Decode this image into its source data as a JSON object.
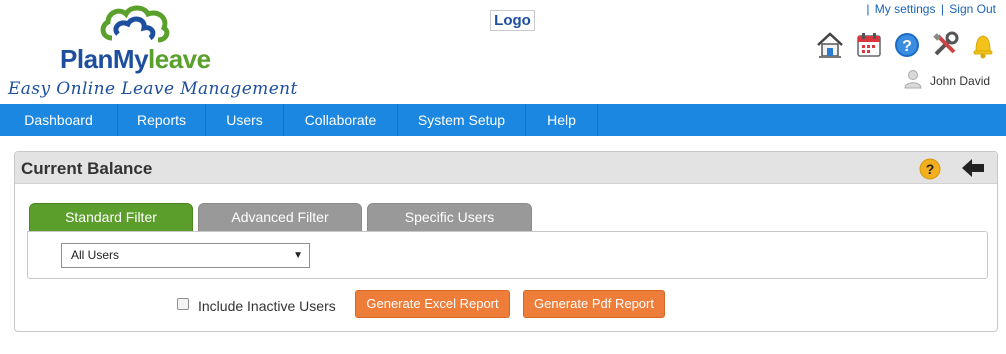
{
  "brand": {
    "name_part1": "PlanMy",
    "name_part2": "leave",
    "tagline": "Easy Online Leave Management",
    "logo_placeholder": "Logo"
  },
  "top_links": {
    "sep1": "|",
    "settings": "My settings",
    "sep2": "|",
    "signout": "Sign Out"
  },
  "toolbar_icons": [
    "home-icon",
    "calendar-icon",
    "help-icon",
    "tools-icon",
    "bell-icon"
  ],
  "user": {
    "name": "John David"
  },
  "nav": {
    "items": [
      "Dashboard",
      "Reports",
      "Users",
      "Collaborate",
      "System Setup",
      "Help"
    ]
  },
  "panel": {
    "title": "Current Balance",
    "tabs": [
      "Standard Filter",
      "Advanced Filter",
      "Specific Users"
    ],
    "active_tab": "Standard Filter",
    "select_value": "All Users",
    "checkbox_label": "Include Inactive Users",
    "checkbox_checked": false,
    "excel_button": "Generate Excel Report",
    "pdf_button": "Generate Pdf Report"
  },
  "colors": {
    "brand_blue": "#1d4f9e",
    "brand_green": "#5aa02c",
    "nav_blue": "#1b87e0",
    "tab_active": "#5b9e2c",
    "tab_inactive": "#999999",
    "button_orange": "#ef7d3a"
  }
}
